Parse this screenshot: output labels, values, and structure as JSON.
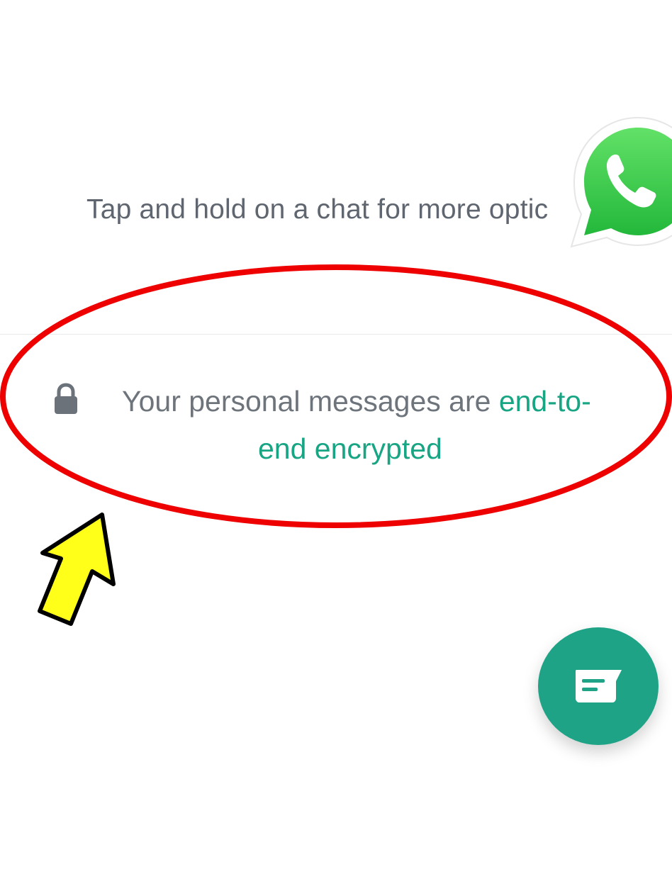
{
  "hint_text": "Tap and hold on a chat for more optic",
  "encryption": {
    "text_prefix": "Your personal messages are ",
    "link_part1": "end-to-",
    "link_part2": "end encrypted",
    "link_color": "#17a584",
    "text_color": "#6e747b"
  },
  "icons": {
    "lock": "lock-icon",
    "fab": "new-chat-icon",
    "logo": "whatsapp-logo-icon",
    "arrow": "yellow-arrow-icon"
  },
  "colors": {
    "accent": "#1fa386",
    "annotation_red": "#ee0000",
    "arrow_yellow": "#ffff1a",
    "whatsapp_green": "#39c94c"
  }
}
